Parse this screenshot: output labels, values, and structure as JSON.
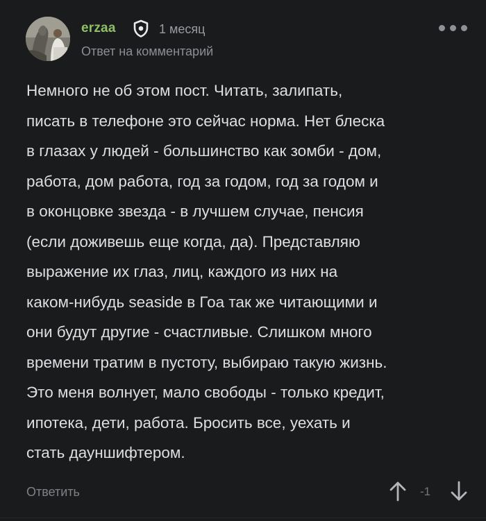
{
  "comment": {
    "author": "erzaa",
    "time": "1 месяц",
    "reply_to": "Ответ на комментарий",
    "text_lines": [
      "Немного не об этом пост. Читать, залипать,",
      "писать в телефоне это сейчас норма. Нет блеска",
      "в глазах у людей - большинство как зомби - дом,",
      "работа, дом работа, год за годом, год за годом и",
      "в оконцовке звезда - в лучшем случае, пенсия",
      "(если доживешь еще когда, да). Представляю",
      "выражение их глаз, лиц, каждого из них на",
      "каком-нибудь seaside в Гоа так же читающими и",
      "они будут другие - счастливые. Слишком много",
      "времени тратим в пустоту, выбираю такую жизнь.",
      "Это меня волнует, мало свободы - только кредит,",
      "ипотека, дети, работа. Бросить все, уехать и",
      "стать дауншифтером."
    ],
    "reply_label": "Ответить",
    "rating": "-1"
  },
  "icons": {
    "avatar": "avatar-photo",
    "badge": "shield-icon",
    "menu": "more-dots-icon",
    "upvote": "arrow-up-icon",
    "downvote": "arrow-down-icon"
  },
  "colors": {
    "background": "#1a1b1d",
    "username": "#8fc065",
    "text": "#dedfe2",
    "muted": "#9a9ca1"
  }
}
